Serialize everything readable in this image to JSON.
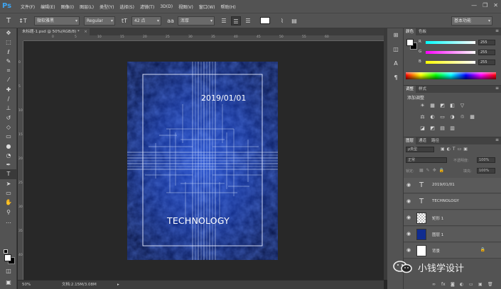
{
  "app": {
    "logo": "Ps"
  },
  "menubar": {
    "items": [
      "文件(F)",
      "编辑(E)",
      "图像(I)",
      "图层(L)",
      "类型(Y)",
      "选择(S)",
      "滤镜(T)",
      "3D(D)",
      "视图(V)",
      "窗口(W)",
      "帮助(H)"
    ],
    "window_controls": [
      "—",
      "❐",
      "✕"
    ]
  },
  "options_bar": {
    "tool_icon": "T",
    "orient_icon": "↕T",
    "font_family": "微软雅黑",
    "font_style": "Regular",
    "size_icon": "tT",
    "font_size": "42 点",
    "aa_icon": "aa",
    "antialias": "浑厚",
    "color_hex": "#ffffff",
    "workspace": "基本功能"
  },
  "document": {
    "tab_title": "未标题-1.psd @ 50%(RGB/8) *",
    "zoom": "50%",
    "doc_size": "文档:2.15M/3.08M",
    "ruler_h": [
      "0",
      "5",
      "10",
      "15",
      "20",
      "25",
      "30",
      "35",
      "40",
      "45",
      "50",
      "55",
      "60"
    ],
    "ruler_v": [
      "0",
      "5",
      "10",
      "15",
      "20",
      "25",
      "30",
      "35",
      "40"
    ],
    "texts": {
      "date": "2019/01/01",
      "headline": "TECHNOLOGY"
    }
  },
  "color_panel": {
    "tabs": [
      "颜色",
      "色板"
    ],
    "channels": [
      {
        "label": "R",
        "value": "255"
      },
      {
        "label": "G",
        "value": "255"
      },
      {
        "label": "B",
        "value": "255"
      }
    ]
  },
  "adjust_panel": {
    "tabs": [
      "调整",
      "样式"
    ],
    "title": "添加调整",
    "rows": [
      [
        "☀",
        "▦",
        "◩",
        "◧",
        "▽"
      ],
      [
        "⚖",
        "◐",
        "▭",
        "◑",
        "♲",
        "▦"
      ],
      [
        "◪",
        "◩",
        "▤",
        "▥"
      ]
    ]
  },
  "layers_panel": {
    "tabs": [
      "图层",
      "通道",
      "路径"
    ],
    "filter_kind": "ρ类型",
    "blend_mode": "正常",
    "opacity_label": "不透明度:",
    "opacity_value": "100%",
    "lock_label": "锁定:",
    "fill_label": "填充:",
    "fill_value": "100%",
    "layers": [
      {
        "name": "2019/01/01",
        "kind": "text",
        "thumb": "T"
      },
      {
        "name": "TECHNOLOGY",
        "kind": "text",
        "thumb": "T"
      },
      {
        "name": "矩形 1",
        "kind": "shape",
        "thumb": ""
      },
      {
        "name": "图层 1",
        "kind": "pixel",
        "thumb": ""
      },
      {
        "name": "背景",
        "kind": "background",
        "thumb": "",
        "lock": "🔒"
      }
    ],
    "footer_icons": [
      "∞",
      "fx",
      "◙",
      "◐",
      "▭",
      "▣",
      "🗑"
    ]
  },
  "watermark": {
    "text": "小钱学设计"
  },
  "colors": {
    "accent": "#3ea4f0",
    "doc_bg": "#08143c",
    "line": "#dce8ff"
  }
}
